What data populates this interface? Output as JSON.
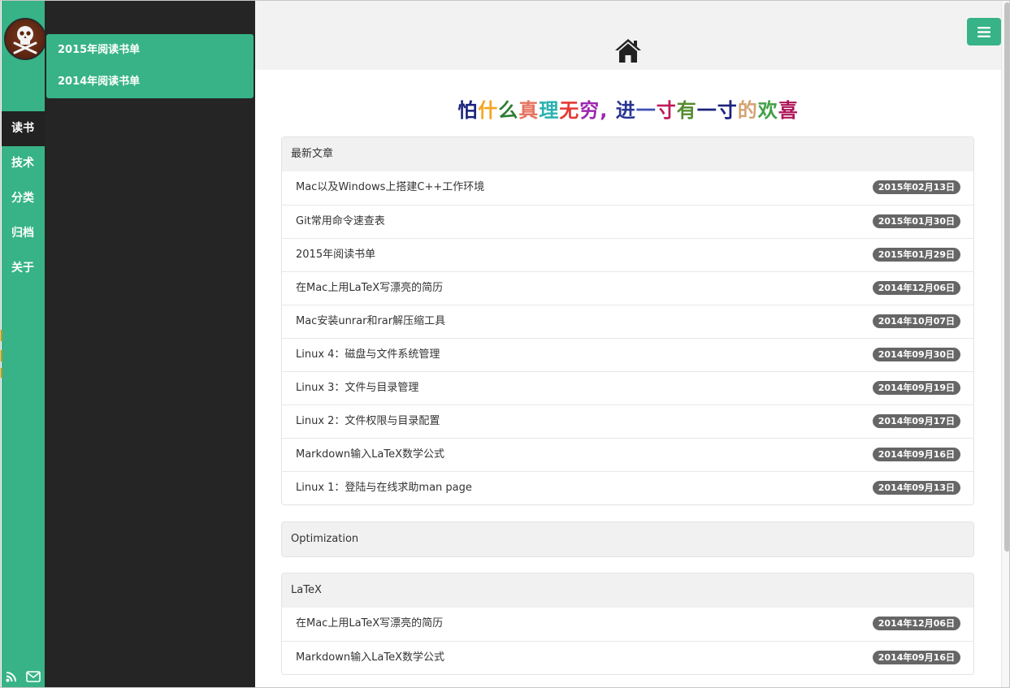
{
  "sidebar": {
    "nav": [
      {
        "label": "读书",
        "active": true
      },
      {
        "label": "技术",
        "active": false
      },
      {
        "label": "分类",
        "active": false
      },
      {
        "label": "归档",
        "active": false
      },
      {
        "label": "关于",
        "active": false
      }
    ],
    "footer_icons": [
      "rss-icon",
      "mail-icon"
    ],
    "accent_color": "#37b387"
  },
  "submenu": {
    "items": [
      {
        "label": "2015年阅读书单"
      },
      {
        "label": "2014年阅读书单"
      }
    ]
  },
  "header": {
    "home_icon": "home-icon",
    "menu_icon": "hamburger-icon"
  },
  "slogan": {
    "chars": [
      {
        "ch": "怕",
        "color": "#1a237e"
      },
      {
        "ch": "什",
        "color": "#f5a623"
      },
      {
        "ch": "么",
        "color": "#2e7d32"
      },
      {
        "ch": "真",
        "color": "#e5735f"
      },
      {
        "ch": "理",
        "color": "#2ab0b0"
      },
      {
        "ch": "无",
        "color": "#e53935"
      },
      {
        "ch": "穷",
        "color": "#9c27b0"
      },
      {
        "ch": ",",
        "color": "#9c27b0"
      },
      {
        "ch": " ",
        "color": "#333333"
      },
      {
        "ch": "进",
        "color": "#283593"
      },
      {
        "ch": "一",
        "color": "#3f51b5"
      },
      {
        "ch": "寸",
        "color": "#c2185b"
      },
      {
        "ch": "有",
        "color": "#558b2f"
      },
      {
        "ch": "一",
        "color": "#1a237e"
      },
      {
        "ch": "寸",
        "color": "#1a237e"
      },
      {
        "ch": "的",
        "color": "#d4a373"
      },
      {
        "ch": "欢",
        "color": "#43a047"
      },
      {
        "ch": "喜",
        "color": "#ad1457"
      }
    ]
  },
  "latest": {
    "heading": "最新文章",
    "posts": [
      {
        "title": "Mac以及Windows上搭建C++工作环境",
        "date": "2015年02月13日"
      },
      {
        "title": "Git常用命令速查表",
        "date": "2015年01月30日"
      },
      {
        "title": "2015年阅读书单",
        "date": "2015年01月29日"
      },
      {
        "title": "在Mac上用LaTeX写漂亮的简历",
        "date": "2014年12月06日"
      },
      {
        "title": "Mac安装unrar和rar解压缩工具",
        "date": "2014年10月07日"
      },
      {
        "title": "Linux 4：磁盘与文件系统管理",
        "date": "2014年09月30日"
      },
      {
        "title": "Linux 3：文件与目录管理",
        "date": "2014年09月19日"
      },
      {
        "title": "Linux 2：文件权限与目录配置",
        "date": "2014年09月17日"
      },
      {
        "title": "Markdown输入LaTeX数学公式",
        "date": "2014年09月16日"
      },
      {
        "title": "Linux 1：登陆与在线求助man page",
        "date": "2014年09月13日"
      }
    ]
  },
  "optimization": {
    "heading": "Optimization"
  },
  "latex": {
    "heading": "LaTeX",
    "posts": [
      {
        "title": "在Mac上用LaTeX写漂亮的简历",
        "date": "2014年12月06日"
      },
      {
        "title": "Markdown输入LaTeX数学公式",
        "date": "2014年09月16日"
      }
    ]
  }
}
